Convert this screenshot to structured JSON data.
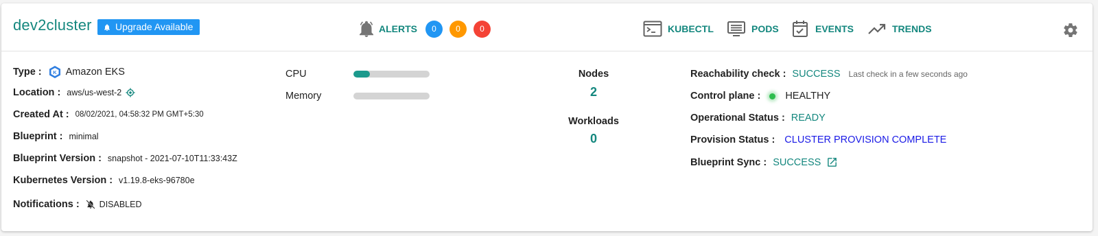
{
  "header": {
    "cluster_name": "dev2cluster",
    "upgrade_label": "Upgrade Available",
    "alerts": {
      "label": "ALERTS",
      "counts": [
        {
          "value": "0",
          "color": "#2196f3"
        },
        {
          "value": "0",
          "color": "#ff9800"
        },
        {
          "value": "0",
          "color": "#f44336"
        }
      ]
    },
    "nav": {
      "kubectl": "KUBECTL",
      "pods": "PODS",
      "events": "EVENTS",
      "trends": "TRENDS"
    }
  },
  "details": {
    "type_label": "Type :",
    "type_value": "Amazon EKS",
    "location_label": "Location :",
    "location_value": "aws/us-west-2",
    "created_label": "Created At :",
    "created_value": "08/02/2021, 04:58:32 PM GMT+5:30",
    "blueprint_label": "Blueprint :",
    "blueprint_value": "minimal",
    "blueprint_version_label": "Blueprint Version :",
    "blueprint_version_value": "snapshot - 2021-07-10T11:33:43Z",
    "k8s_version_label": "Kubernetes Version :",
    "k8s_version_value": "v1.19.8-eks-96780e",
    "notifications_label": "Notifications :",
    "notifications_value": "DISABLED"
  },
  "usage": {
    "cpu_label": "CPU",
    "cpu_fraction": 0.22,
    "memory_label": "Memory",
    "memory_fraction": 0.0
  },
  "stats": {
    "nodes_label": "Nodes",
    "nodes_value": "2",
    "workloads_label": "Workloads",
    "workloads_value": "0"
  },
  "status": {
    "reachability_label": "Reachability check :",
    "reachability_value": "SUCCESS",
    "reachability_note": "Last check in a few seconds ago",
    "control_plane_label": "Control plane :",
    "control_plane_value": "HEALTHY",
    "operational_label": "Operational Status :",
    "operational_value": "READY",
    "provision_label": "Provision Status :",
    "provision_value": "CLUSTER PROVISION COMPLETE",
    "blueprint_sync_label": "Blueprint Sync :",
    "blueprint_sync_value": "SUCCESS"
  },
  "icons": {
    "upgrade": "bell-icon",
    "alerts": "alarm-bell-icon",
    "kubectl": "terminal-icon",
    "pods": "monitor-list-icon",
    "events": "calendar-check-icon",
    "trends": "trending-up-icon",
    "settings": "gear-icon",
    "type": "eks-logo-icon",
    "location": "location-target-icon",
    "notifications": "bell-off-icon",
    "blueprint_sync": "external-link-icon"
  }
}
